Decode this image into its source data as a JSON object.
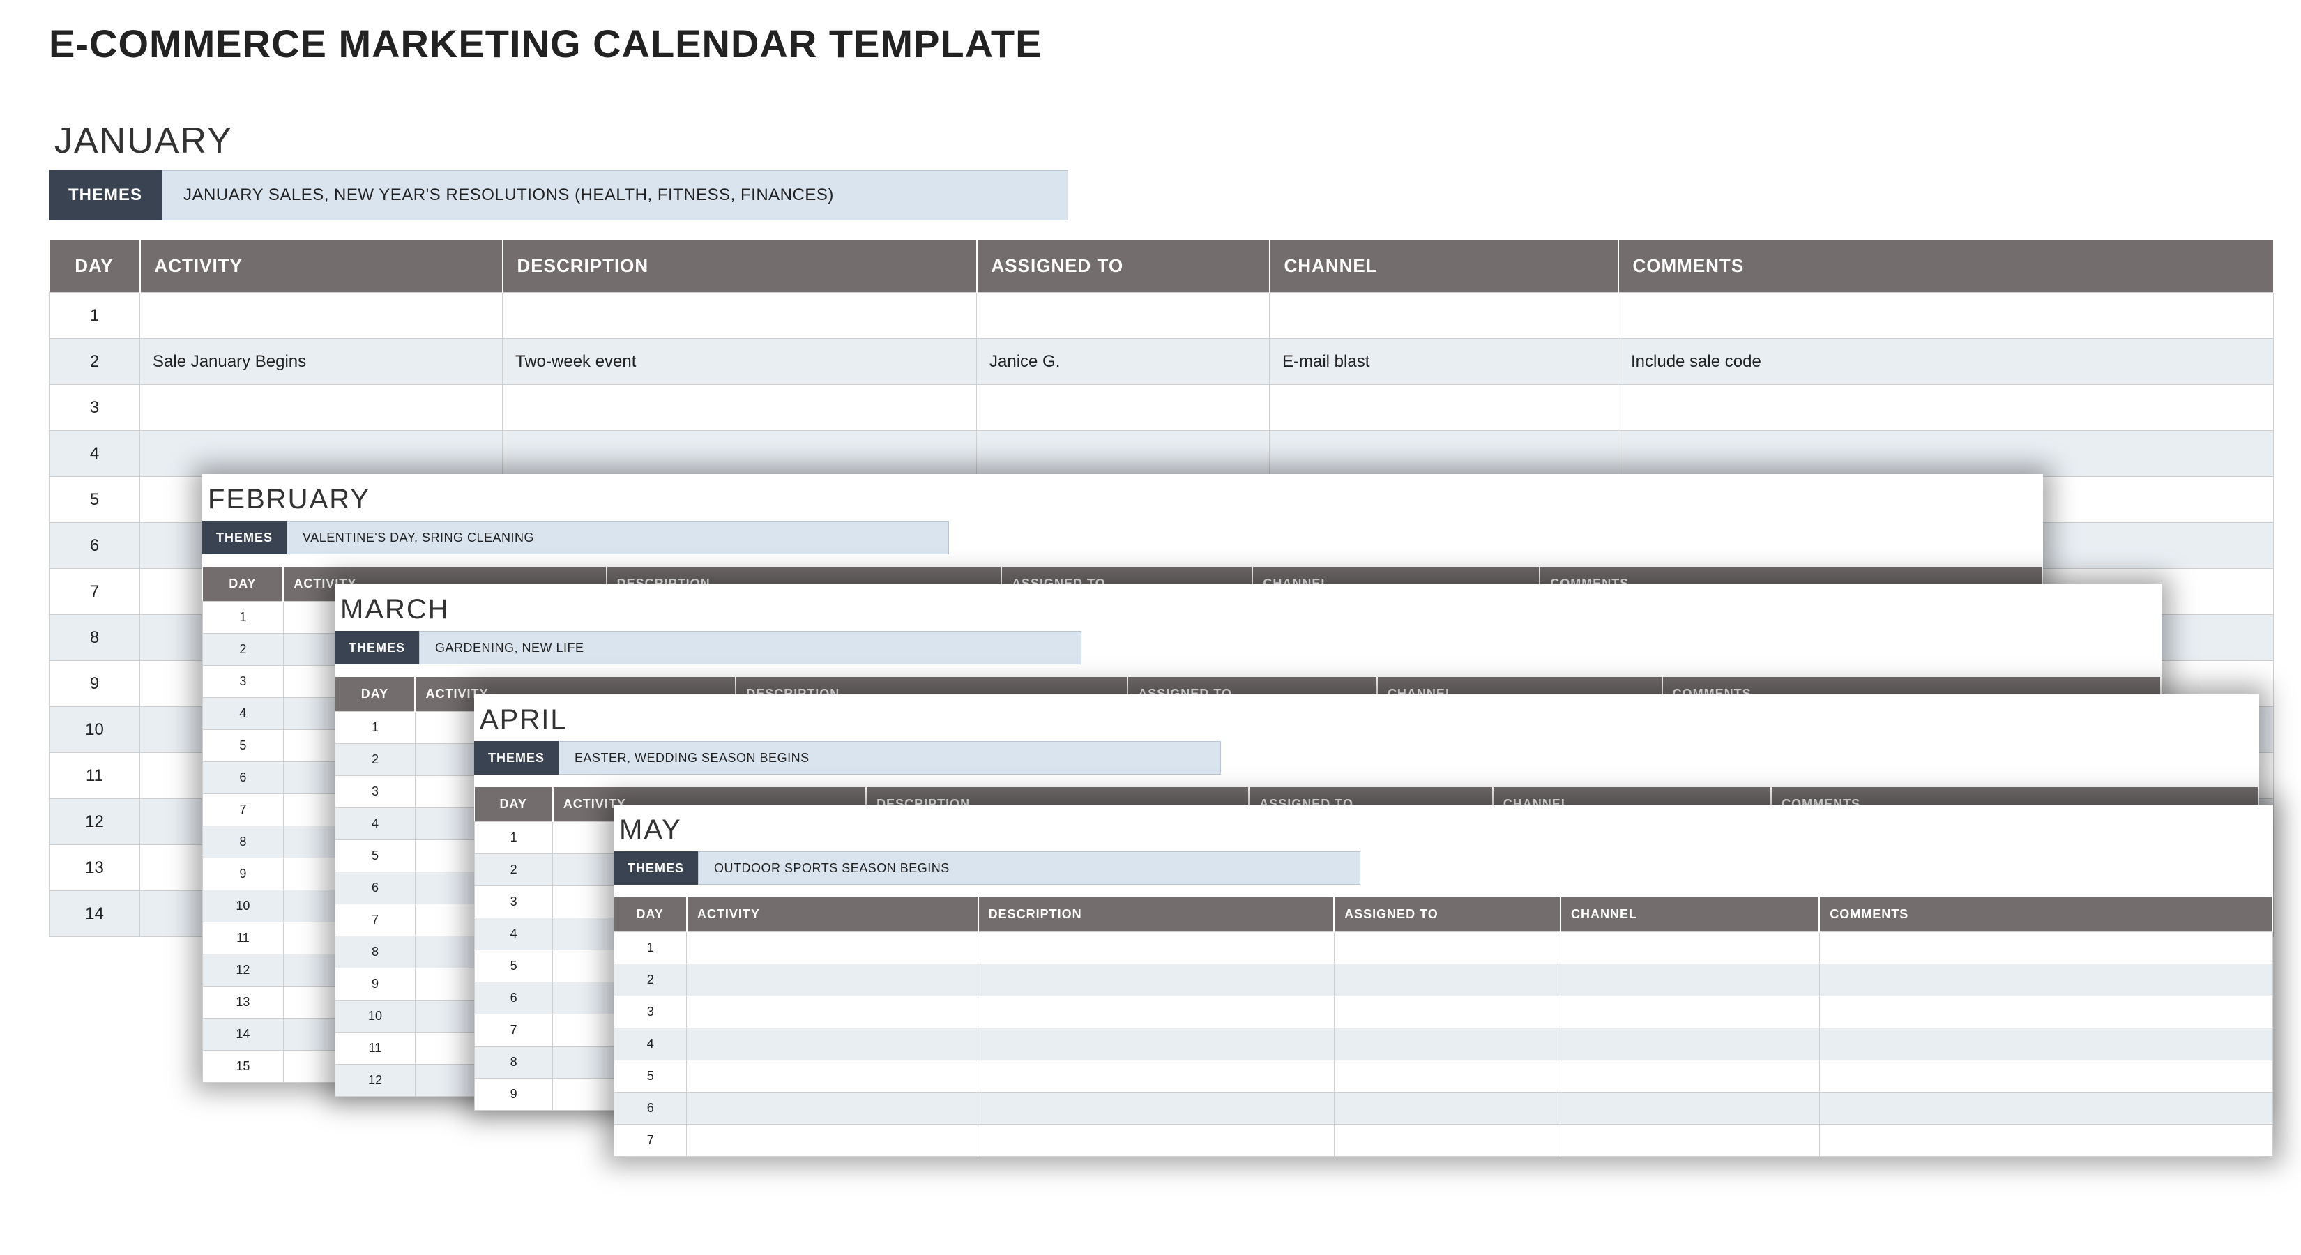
{
  "title": "E-COMMERCE MARKETING CALENDAR TEMPLATE",
  "themes_label": "THEMES",
  "columns": {
    "day": "DAY",
    "activity": "ACTIVITY",
    "description": "DESCRIPTION",
    "assigned": "ASSIGNED TO",
    "channel": "CHANNEL",
    "comments": "COMMENTS"
  },
  "months": {
    "january": {
      "name": "JANUARY",
      "themes": "JANUARY SALES, NEW YEAR'S RESOLUTIONS (HEALTH, FITNESS, FINANCES)",
      "rows": [
        {
          "day": "1",
          "activity": "",
          "description": "",
          "assigned": "",
          "channel": "",
          "comments": ""
        },
        {
          "day": "2",
          "activity": "Sale January Begins",
          "description": "Two-week event",
          "assigned": "Janice G.",
          "channel": "E-mail blast",
          "comments": "Include sale code"
        },
        {
          "day": "3"
        },
        {
          "day": "4"
        },
        {
          "day": "5"
        },
        {
          "day": "6"
        },
        {
          "day": "7"
        },
        {
          "day": "8"
        },
        {
          "day": "9"
        },
        {
          "day": "10"
        },
        {
          "day": "11"
        },
        {
          "day": "12"
        },
        {
          "day": "13"
        },
        {
          "day": "14"
        }
      ]
    },
    "february": {
      "name": "FEBRUARY",
      "themes": "VALENTINE'S DAY, SRING CLEANING",
      "rows": [
        {
          "day": "1"
        },
        {
          "day": "2"
        },
        {
          "day": "3"
        },
        {
          "day": "4"
        },
        {
          "day": "5"
        },
        {
          "day": "6"
        },
        {
          "day": "7"
        },
        {
          "day": "8"
        },
        {
          "day": "9"
        },
        {
          "day": "10"
        },
        {
          "day": "11"
        },
        {
          "day": "12"
        },
        {
          "day": "13"
        },
        {
          "day": "14"
        },
        {
          "day": "15"
        }
      ]
    },
    "march": {
      "name": "MARCH",
      "themes": "GARDENING, NEW LIFE",
      "rows": [
        {
          "day": "1"
        },
        {
          "day": "2"
        },
        {
          "day": "3"
        },
        {
          "day": "4"
        },
        {
          "day": "5"
        },
        {
          "day": "6"
        },
        {
          "day": "7"
        },
        {
          "day": "8"
        },
        {
          "day": "9"
        },
        {
          "day": "10"
        },
        {
          "day": "11"
        },
        {
          "day": "12"
        }
      ]
    },
    "april": {
      "name": "APRIL",
      "themes": "EASTER, WEDDING SEASON BEGINS",
      "rows": [
        {
          "day": "1"
        },
        {
          "day": "2"
        },
        {
          "day": "3"
        },
        {
          "day": "4"
        },
        {
          "day": "5"
        },
        {
          "day": "6"
        },
        {
          "day": "7"
        },
        {
          "day": "8"
        },
        {
          "day": "9"
        }
      ]
    },
    "may": {
      "name": "MAY",
      "themes": "OUTDOOR SPORTS SEASON BEGINS",
      "rows": [
        {
          "day": "1"
        },
        {
          "day": "2"
        },
        {
          "day": "3"
        },
        {
          "day": "4"
        },
        {
          "day": "5"
        },
        {
          "day": "6"
        },
        {
          "day": "7"
        }
      ]
    }
  }
}
